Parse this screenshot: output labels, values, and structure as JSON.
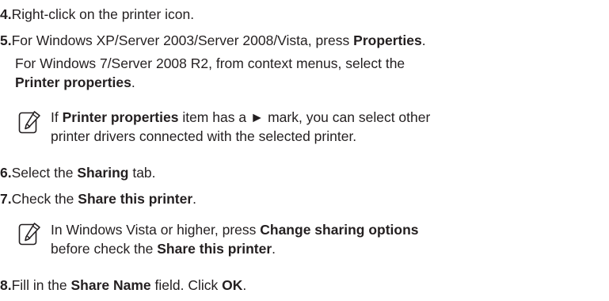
{
  "steps": [
    {
      "num": "4.",
      "parts": [
        "Right-click on the printer icon."
      ]
    },
    {
      "num": "5.",
      "parts": [
        "For Windows XP/Server 2003/Server 2008/Vista, press ",
        "Properties",
        "."
      ],
      "sub_line1": "For Windows 7/Server 2008 R2, from context menus, select the",
      "sub_line2_bold": "Printer properties",
      "sub_line2_tail": "."
    },
    {
      "num": "6.",
      "parts": [
        "Select the ",
        "Sharing",
        " tab."
      ]
    },
    {
      "num": "7.",
      "parts": [
        "Check the ",
        "Share this printer",
        "."
      ]
    },
    {
      "num": "8.",
      "parts": [
        "Fill in the ",
        "Share Name",
        " field. Click ",
        "OK",
        "."
      ]
    }
  ],
  "notes": [
    {
      "icon": "note-pencil-icon",
      "line1": [
        "If ",
        "Printer properties",
        " item has a ► mark, you can select other"
      ],
      "line2": "printer drivers connected with the selected printer."
    },
    {
      "icon": "note-pencil-icon",
      "line1": [
        "In Windows Vista or higher, press ",
        "Change sharing options"
      ],
      "line2": [
        "before check the ",
        "Share this printer",
        "."
      ]
    }
  ]
}
